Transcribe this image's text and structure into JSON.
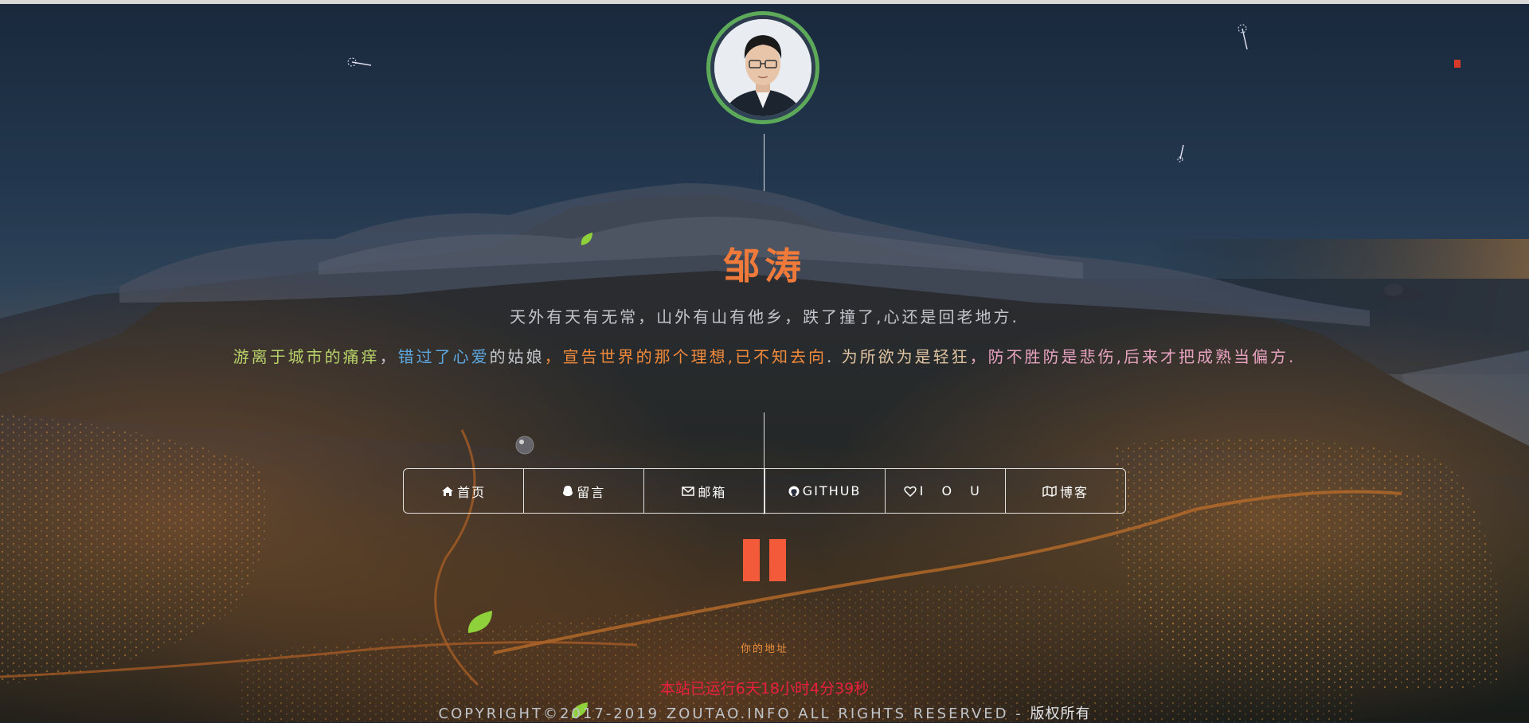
{
  "profile": {
    "name": "邹涛",
    "avatar_alt": "avatar"
  },
  "motto": {
    "line1": "天外有天有无常，山外有山有他乡，跌了撞了,心还是回老地方.",
    "line2_segments": [
      {
        "text": "游离于城市的痛痒",
        "color": "lime"
      },
      {
        "text": "，",
        "color": "gray"
      },
      {
        "text": "错过了心爱",
        "color": "blue"
      },
      {
        "text": "的姑娘",
        "color": "gray"
      },
      {
        "text": "，宣告世界的那个理想,已不知去向",
        "color": "orange"
      },
      {
        "text": ". ",
        "color": "gray"
      },
      {
        "text": "为所欲为是轻狂",
        "color": "beige"
      },
      {
        "text": "，防不胜防是悲伤,后来才把成熟当偏方.",
        "color": "pink"
      }
    ]
  },
  "nav": {
    "home": "首页",
    "message": "留言",
    "mail": "邮箱",
    "github": "GITHUB",
    "iou": "I O U",
    "blog": "博客"
  },
  "icons": {
    "home": "home-icon",
    "message": "qq-icon",
    "mail": "envelope-icon",
    "github": "github-icon",
    "iou": "heart-icon",
    "blog": "map-icon",
    "music": "pause-icon"
  },
  "footer": {
    "address_label": "你的地址",
    "runtime": "本站已运行6天18小时4分39秒",
    "copyright": "COPYRIGHT©2017-2019 ZOUTAO.INFO ALL RIGHTS RESERVED - ",
    "copyright_cn": "版权所有"
  },
  "colors": {
    "accent_orange": "#f07a3a",
    "avatar_ring": "#5da95a",
    "runtime_red": "#e8203e",
    "pause_red": "#f25a3a"
  }
}
